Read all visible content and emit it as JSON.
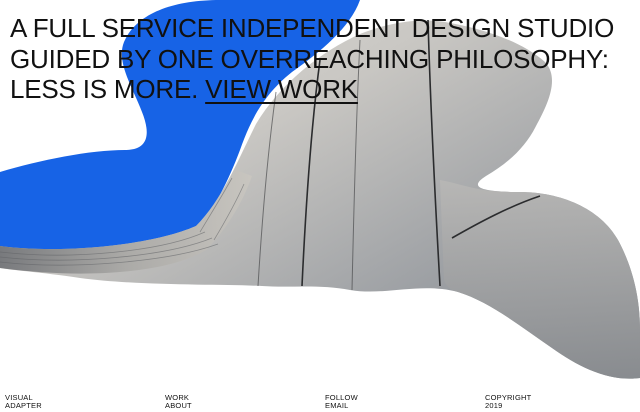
{
  "colors": {
    "background": "#ffffff",
    "text": "#111111",
    "accent_blue": "#1763e6",
    "facade_light": "#d9d7d3",
    "facade_shadow": "#7e8184"
  },
  "hero": {
    "line_1": "A FULL SERVICE INDEPENDENT DESIGN STUDIO",
    "line_2": "GUIDED BY ONE OVERREACHING PHILOSOPHY:",
    "line_3": "LESS IS MORE.",
    "cta": "VIEW WORK"
  },
  "footer": {
    "brand_line_1": "VISUAL",
    "brand_line_2": "ADAPTER",
    "work": "WORK",
    "about": "ABOUT",
    "follow": "FOLLOW",
    "email": "EMAIL",
    "copyright": "COPYRIGHT",
    "year": "2019"
  }
}
